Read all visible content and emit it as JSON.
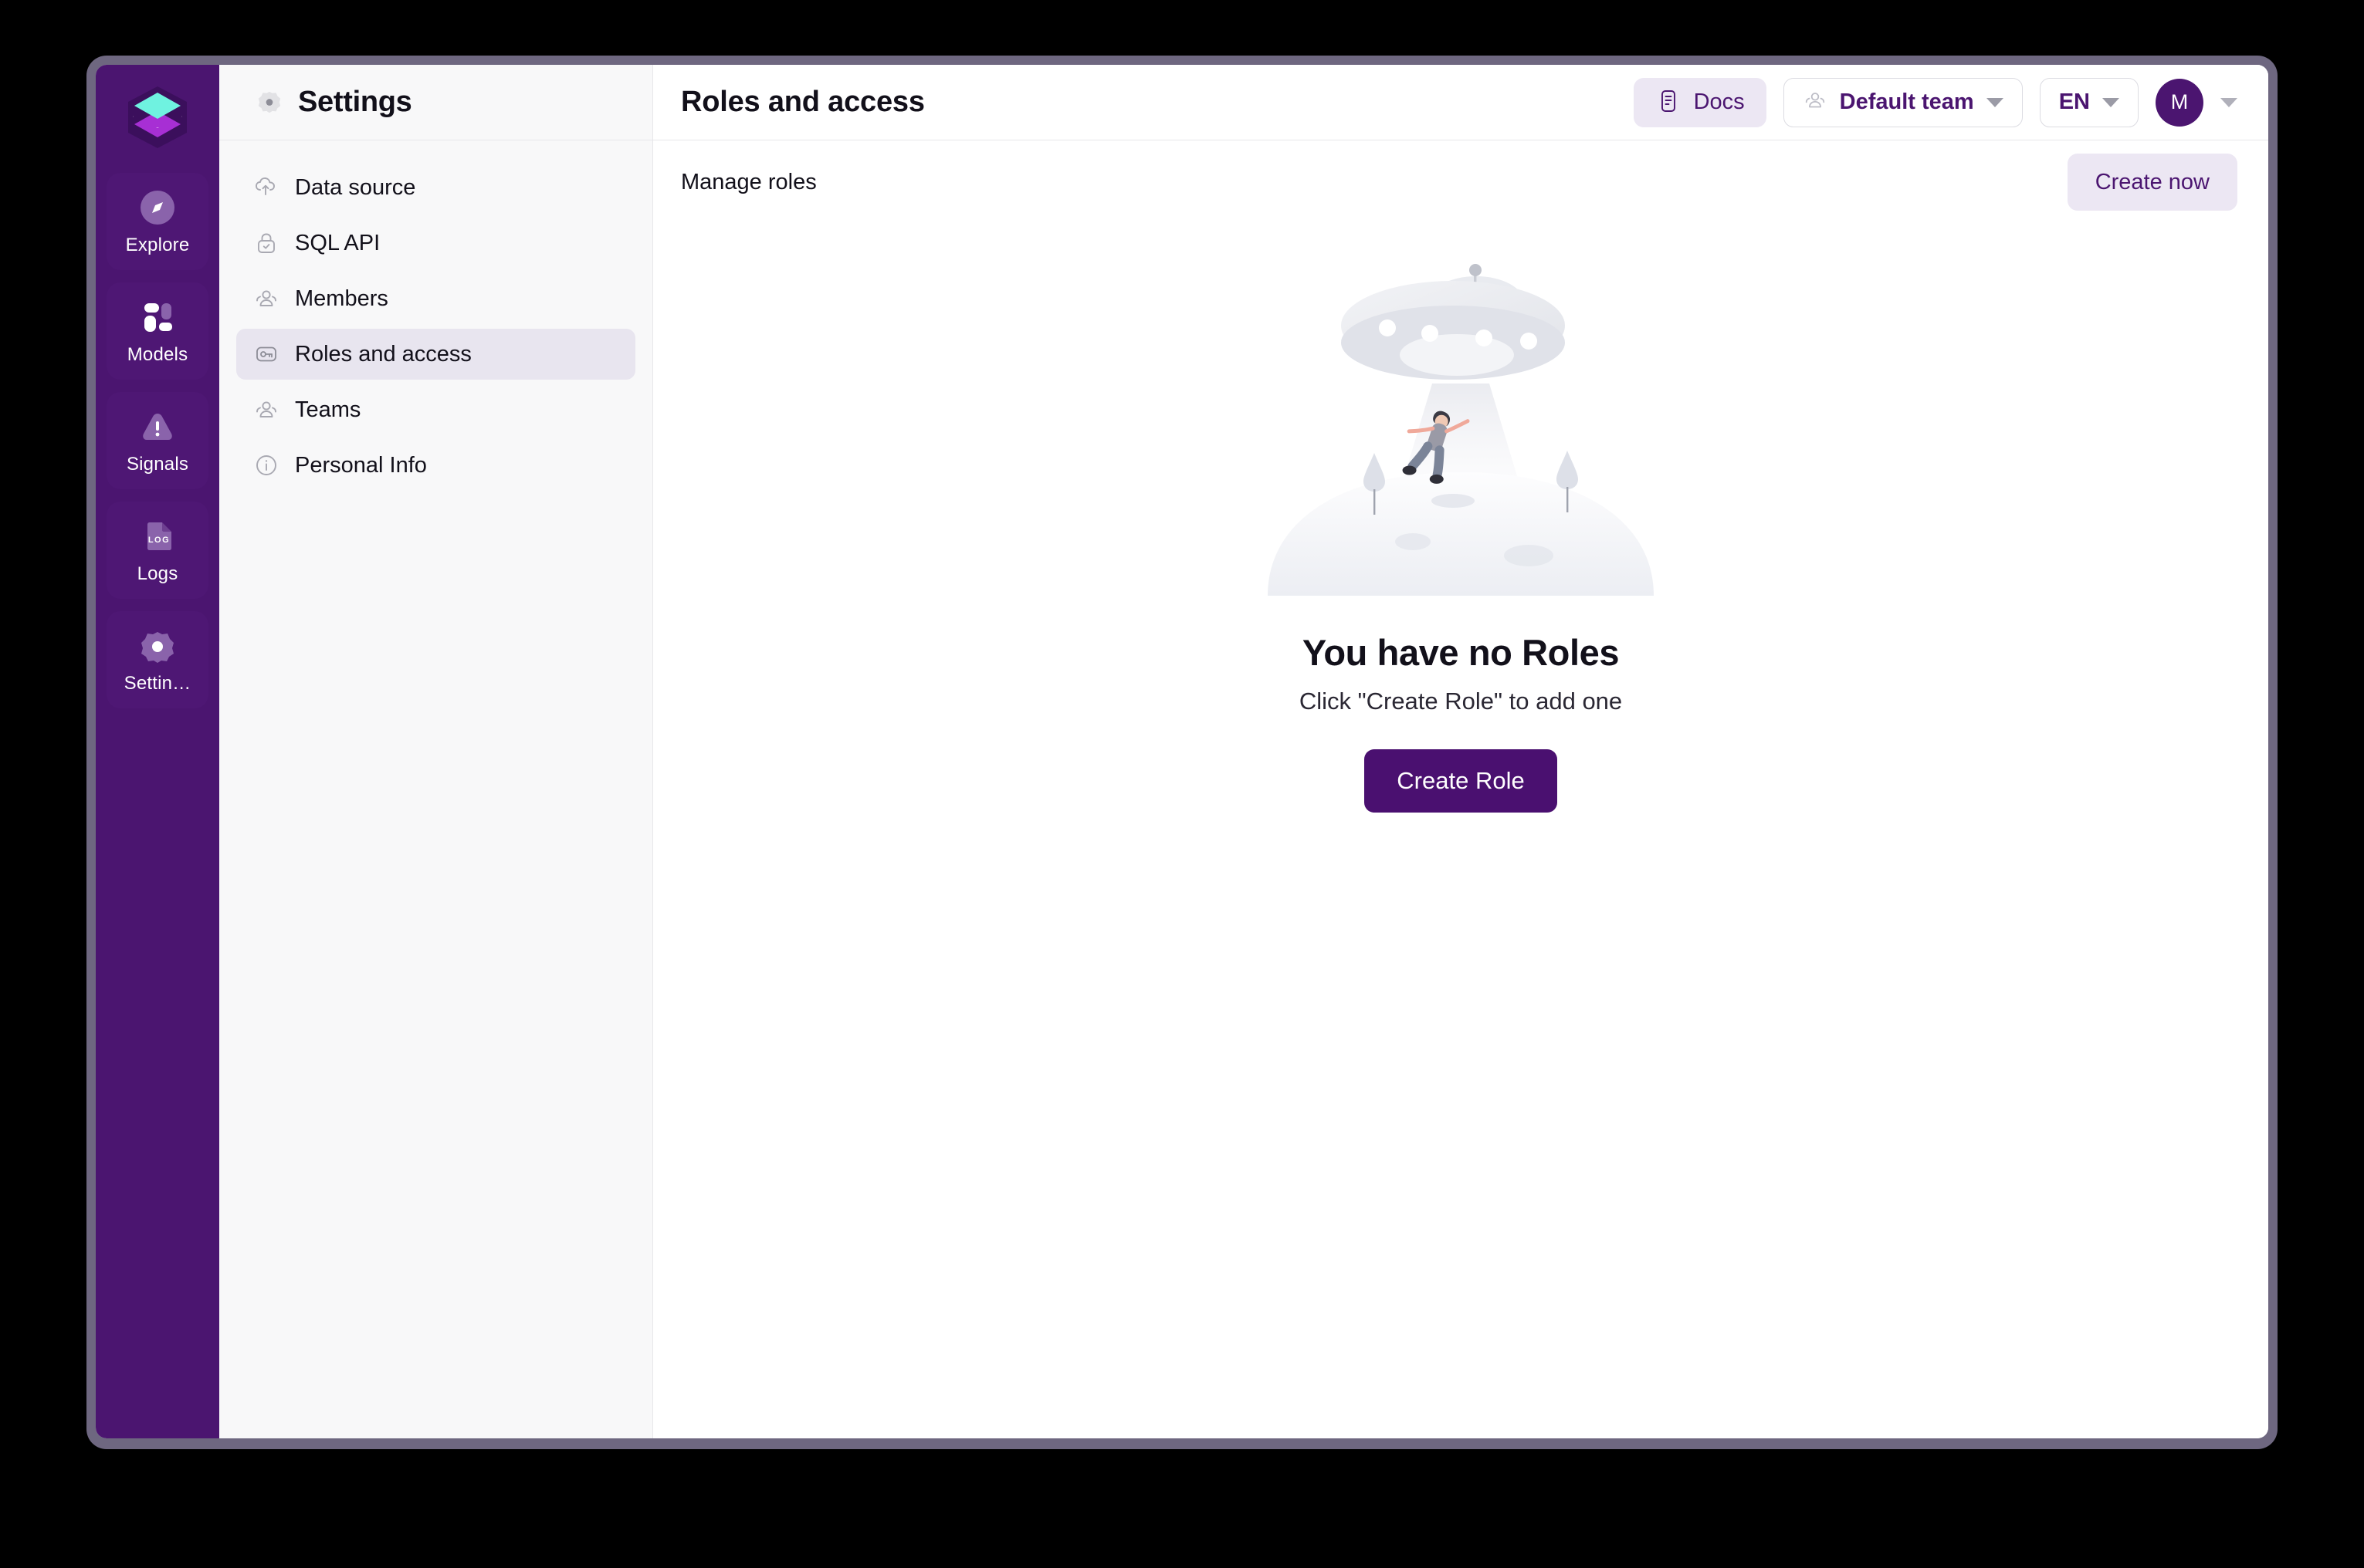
{
  "app_rail": {
    "logo_name": "layers-logo",
    "items": [
      {
        "label": "Explore",
        "icon": "compass-icon",
        "active": false
      },
      {
        "label": "Models",
        "icon": "blocks-icon",
        "active": false
      },
      {
        "label": "Signals",
        "icon": "alert-triangle-icon",
        "active": false
      },
      {
        "label": "Logs",
        "icon": "log-file-icon",
        "active": false
      },
      {
        "label": "Settin…",
        "icon": "gear-icon",
        "active": true
      }
    ]
  },
  "settings_panel": {
    "title": "Settings",
    "title_icon": "gear-icon",
    "items": [
      {
        "label": "Data source",
        "icon": "cloud-upload-icon",
        "active": false
      },
      {
        "label": "SQL API",
        "icon": "lock-check-icon",
        "active": false
      },
      {
        "label": "Members",
        "icon": "users-icon",
        "active": false
      },
      {
        "label": "Roles and access",
        "icon": "key-icon",
        "active": true
      },
      {
        "label": "Teams",
        "icon": "users-icon",
        "active": false
      },
      {
        "label": "Personal Info",
        "icon": "info-circle-icon",
        "active": false
      }
    ]
  },
  "topbar": {
    "page_title": "Roles and access",
    "docs_label": "Docs",
    "docs_icon": "document-icon",
    "team_label": "Default team",
    "team_icon": "users-icon",
    "language_label": "EN",
    "avatar_initial": "M"
  },
  "subbar": {
    "section_label": "Manage roles",
    "create_now_label": "Create now"
  },
  "empty_state": {
    "illustration": "ufo-abduction-illustration",
    "title": "You have no Roles",
    "subtitle": "Click \"Create Role\" to add one",
    "button_label": "Create Role"
  },
  "colors": {
    "brand_purple": "#4b1570",
    "deep_purple": "#4a1070",
    "accent_cyan": "#6ff2e0",
    "accent_magenta": "#a72fd4",
    "soft_purple_bg": "#ece7f3",
    "panel_bg": "#f8f8f9",
    "active_nav_bg": "#e8e5ef",
    "window_frame": "#6e6780"
  }
}
